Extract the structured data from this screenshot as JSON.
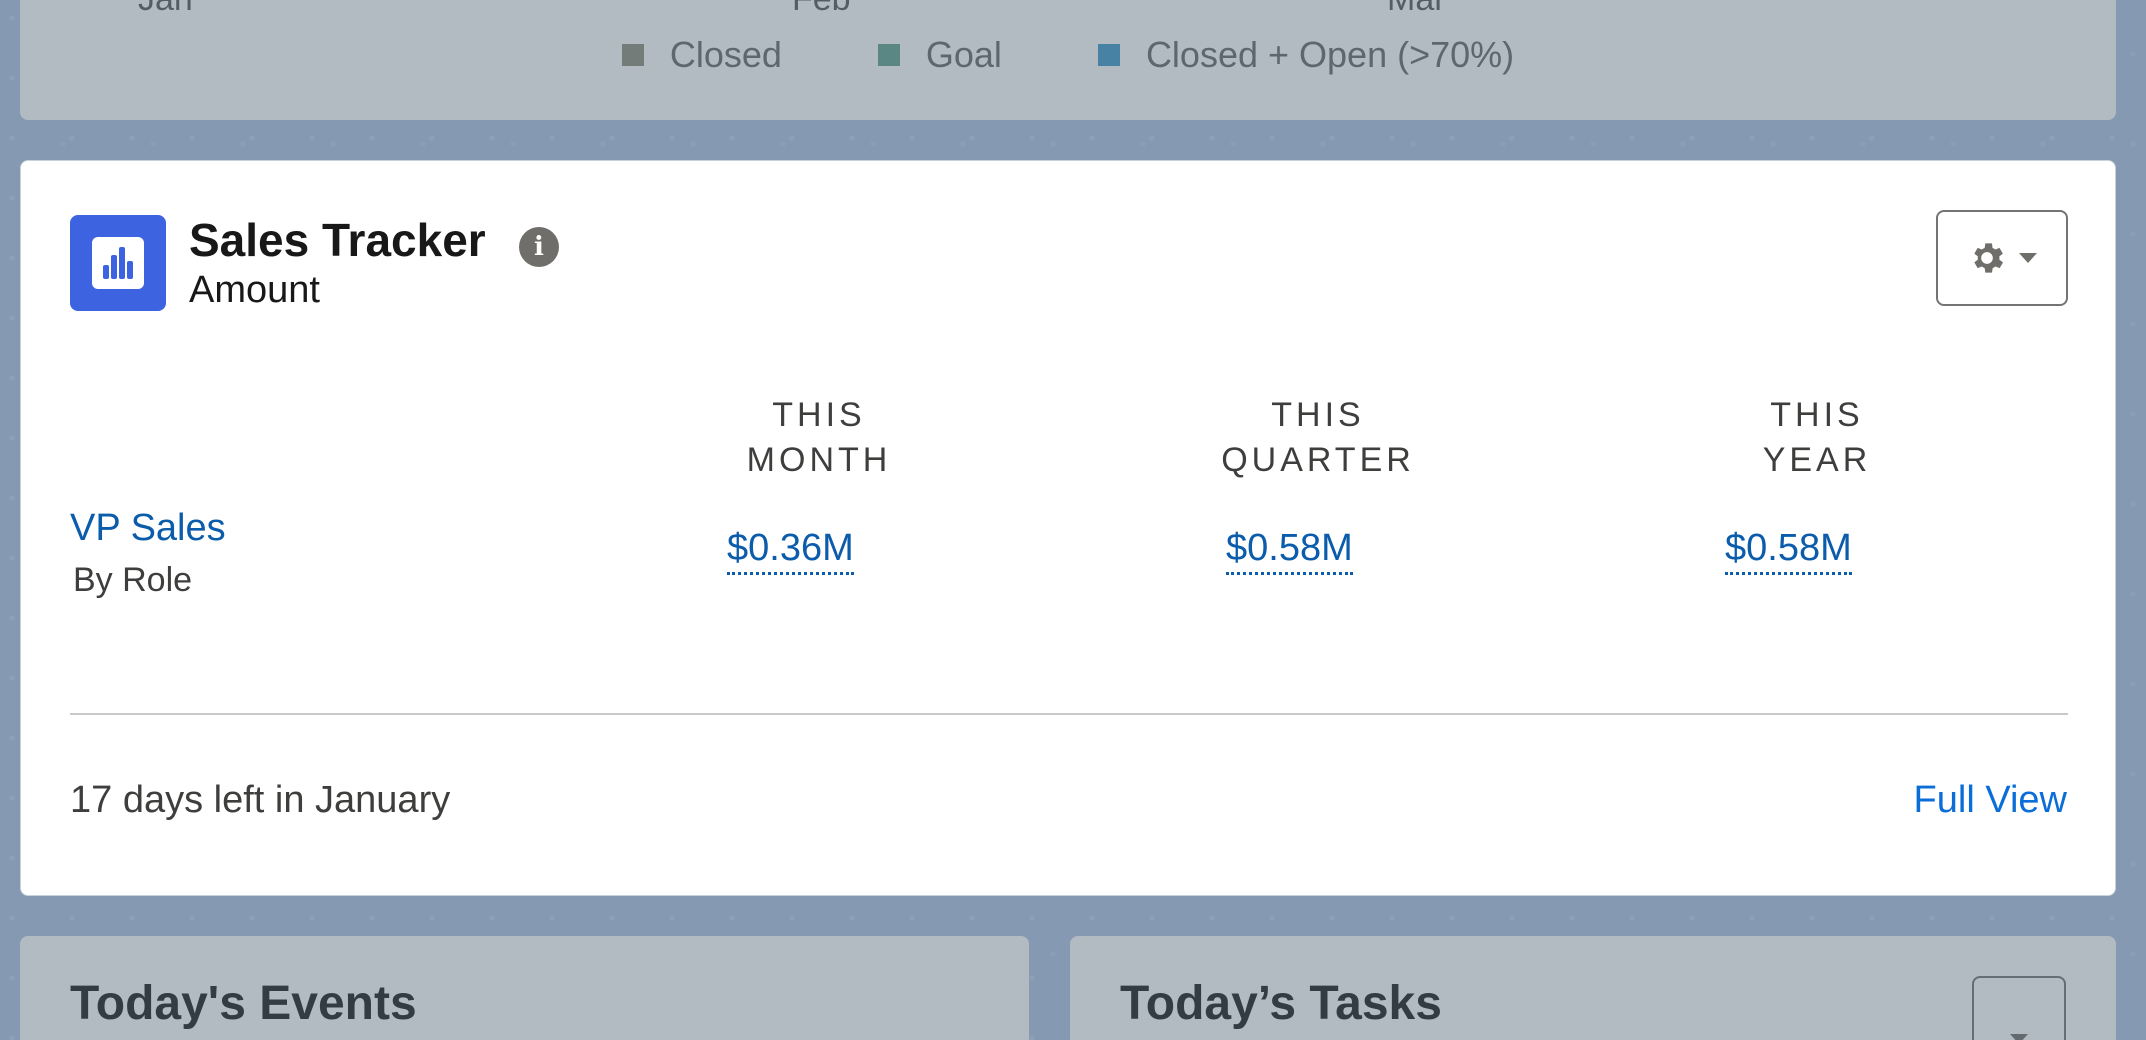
{
  "background_chart": {
    "x_labels": [
      "Jan",
      "Feb",
      "Mar"
    ],
    "legend": [
      {
        "label": "Closed",
        "color": "#8c8c78"
      },
      {
        "label": "Goal",
        "color": "#5fa08c"
      },
      {
        "label": "Closed + Open (>70%)",
        "color": "#3c96c8"
      }
    ]
  },
  "card": {
    "title": "Sales Tracker",
    "subtitle": "Amount",
    "info_glyph": "i",
    "icon": "bar-chart-icon",
    "settings_icon": "gear-icon",
    "columns": [
      {
        "line1": "THIS",
        "line2": "MONTH"
      },
      {
        "line1": "THIS",
        "line2": "QUARTER"
      },
      {
        "line1": "THIS",
        "line2": "YEAR"
      }
    ],
    "row": {
      "title": "VP Sales",
      "subtitle": "By Role",
      "values": [
        "$0.36M",
        "$0.58M",
        "$0.58M"
      ]
    },
    "footer_text": "17 days left in January",
    "full_view_label": "Full View"
  },
  "events_card": {
    "title": "Today's Events"
  },
  "tasks_card": {
    "title": "Today’s Tasks"
  },
  "colors": {
    "brand_blue": "#3d63e0",
    "link_blue": "#0b5cab"
  }
}
